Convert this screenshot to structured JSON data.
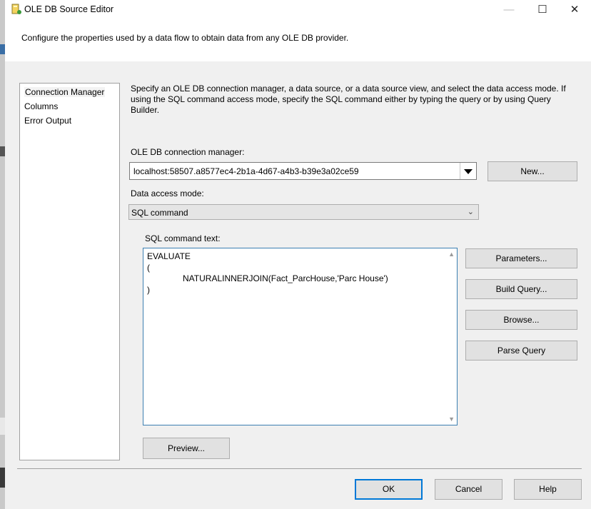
{
  "window": {
    "title": "OLE DB Source Editor",
    "description": "Configure the properties used by a data flow to obtain data from any OLE DB provider."
  },
  "nav": {
    "items": [
      {
        "label": "Connection Manager"
      },
      {
        "label": "Columns"
      },
      {
        "label": "Error Output"
      }
    ]
  },
  "connection_page": {
    "instructions": "Specify an OLE DB connection manager, a data source, or a data source view, and select the data access mode. If using the SQL command access mode, specify the SQL command either by typing the query or by using Query Builder.",
    "connection_manager_label": "OLE DB connection manager:",
    "connection_manager_value": "localhost:58507.a8577ec4-2b1a-4d67-a4b3-b39e3a02ce59",
    "new_button": "New...",
    "data_access_mode_label": "Data access mode:",
    "data_access_mode_value": "SQL command",
    "sql_command_label": "SQL command text:",
    "sql_command_text": "EVALUATE\n(\n               NATURALINNERJOIN(Fact_ParcHouse,'Parc House')\n)",
    "parameters_button": "Parameters...",
    "build_query_button": "Build Query...",
    "browse_button": "Browse...",
    "parse_query_button": "Parse Query",
    "preview_button": "Preview..."
  },
  "footer": {
    "ok": "OK",
    "cancel": "Cancel",
    "help": "Help"
  },
  "window_controls": {
    "minimize": "—",
    "maximize": "☐",
    "close": "✕"
  },
  "colors": {
    "accent": "#0078d7",
    "focus_border": "#3c7fb1",
    "button_face": "#e1e1e1"
  }
}
